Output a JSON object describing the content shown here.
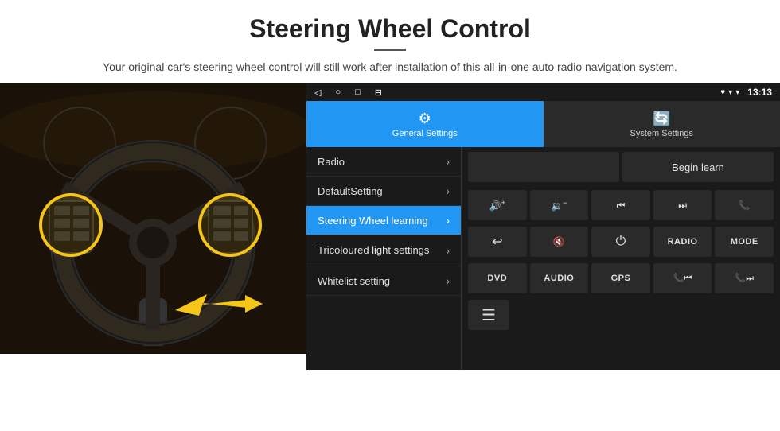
{
  "header": {
    "title": "Steering Wheel Control",
    "subtitle": "Your original car's steering wheel control will still work after installation of this all-in-one auto radio navigation system."
  },
  "statusbar": {
    "time": "13:13",
    "wifi": "▾",
    "signal": "▾"
  },
  "tabs": [
    {
      "id": "general",
      "label": "General Settings",
      "active": true,
      "icon": "⚙"
    },
    {
      "id": "system",
      "label": "System Settings",
      "active": false,
      "icon": "🔄"
    }
  ],
  "menu": [
    {
      "id": "radio",
      "label": "Radio",
      "active": false
    },
    {
      "id": "default",
      "label": "DefaultSetting",
      "active": false
    },
    {
      "id": "steering",
      "label": "Steering Wheel learning",
      "active": true
    },
    {
      "id": "tricoloured",
      "label": "Tricoloured light settings",
      "active": false
    },
    {
      "id": "whitelist",
      "label": "Whitelist setting",
      "active": false
    }
  ],
  "controls": {
    "begin_learn": "Begin learn",
    "buttons": [
      {
        "id": "vol-up",
        "label": "🔊+",
        "type": "icon"
      },
      {
        "id": "vol-down",
        "label": "🔉−",
        "type": "icon"
      },
      {
        "id": "prev",
        "label": "⏮",
        "type": "icon"
      },
      {
        "id": "next",
        "label": "⏭",
        "type": "icon"
      },
      {
        "id": "phone",
        "label": "📞",
        "type": "icon"
      },
      {
        "id": "hangup",
        "label": "↩",
        "type": "icon"
      },
      {
        "id": "mute",
        "label": "🔇×",
        "type": "icon"
      },
      {
        "id": "power",
        "label": "⏻",
        "type": "icon"
      },
      {
        "id": "radio-btn",
        "label": "RADIO",
        "type": "text"
      },
      {
        "id": "mode",
        "label": "MODE",
        "type": "text"
      },
      {
        "id": "dvd",
        "label": "DVD",
        "type": "text"
      },
      {
        "id": "audio",
        "label": "AUDIO",
        "type": "text"
      },
      {
        "id": "gps",
        "label": "GPS",
        "type": "text"
      },
      {
        "id": "phone-prev",
        "label": "📞⏮",
        "type": "icon"
      },
      {
        "id": "phone-next",
        "label": "📞⏭",
        "type": "icon"
      }
    ],
    "single_btn": {
      "id": "menu-icon",
      "label": "≡"
    }
  }
}
